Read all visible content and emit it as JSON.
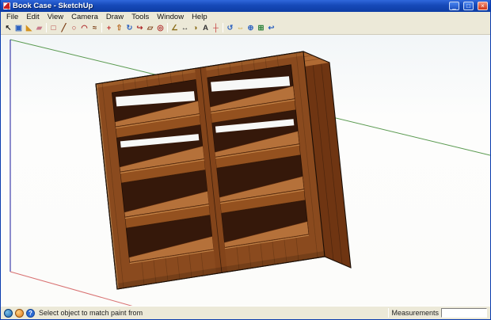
{
  "window": {
    "title": "Book Case - SketchUp",
    "minimize_glyph": "_",
    "maximize_glyph": "□",
    "close_glyph": "×"
  },
  "menu": {
    "items": [
      "File",
      "Edit",
      "View",
      "Camera",
      "Draw",
      "Tools",
      "Window",
      "Help"
    ]
  },
  "toolbar": {
    "tools": [
      {
        "name": "select-tool",
        "glyph": "↖"
      },
      {
        "name": "make-component-tool",
        "glyph": "▣"
      },
      {
        "name": "paint-bucket-tool",
        "glyph": "◣"
      },
      {
        "name": "eraser-tool",
        "glyph": "▰"
      },
      {
        "name": "rectangle-tool",
        "glyph": "□"
      },
      {
        "name": "line-tool",
        "glyph": "╱"
      },
      {
        "name": "circle-tool",
        "glyph": "○"
      },
      {
        "name": "arc-tool",
        "glyph": "◠"
      },
      {
        "name": "freehand-tool",
        "glyph": "≈"
      },
      {
        "name": "move-tool",
        "glyph": "+"
      },
      {
        "name": "push-pull-tool",
        "glyph": "⇧"
      },
      {
        "name": "rotate-tool",
        "glyph": "↻"
      },
      {
        "name": "follow-me-tool",
        "glyph": "↪"
      },
      {
        "name": "scale-tool",
        "glyph": "▱"
      },
      {
        "name": "offset-tool",
        "glyph": "◎"
      },
      {
        "name": "tape-measure-tool",
        "glyph": "∠"
      },
      {
        "name": "dimension-tool",
        "glyph": "↔"
      },
      {
        "name": "protractor-tool",
        "glyph": "◑"
      },
      {
        "name": "text-tool",
        "glyph": "A"
      },
      {
        "name": "axes-tool",
        "glyph": "┼"
      },
      {
        "name": "orbit-tool",
        "glyph": "↺"
      },
      {
        "name": "pan-tool",
        "glyph": "⇔"
      },
      {
        "name": "zoom-tool",
        "glyph": "⊕"
      },
      {
        "name": "zoom-extents-tool",
        "glyph": "⊞"
      },
      {
        "name": "previous-view-tool",
        "glyph": "↩"
      }
    ]
  },
  "viewport": {
    "model_name": "Book Case",
    "axes": {
      "green": "#5a9a50",
      "blue": "#1a1a9c",
      "red": "#d87070"
    },
    "bookcase": {
      "colors": {
        "front": "#8a4a1e",
        "top": "#b06a33",
        "side": "#6f3512",
        "interior": "#35180a",
        "shelf_surface": "#b5713a",
        "shelf_front": "#94511f",
        "outline": "#1a0d04"
      }
    }
  },
  "statusbar": {
    "message": "Select object to match paint from",
    "help_glyph": "?",
    "measurements_label": "Measurements",
    "measurements_value": ""
  }
}
